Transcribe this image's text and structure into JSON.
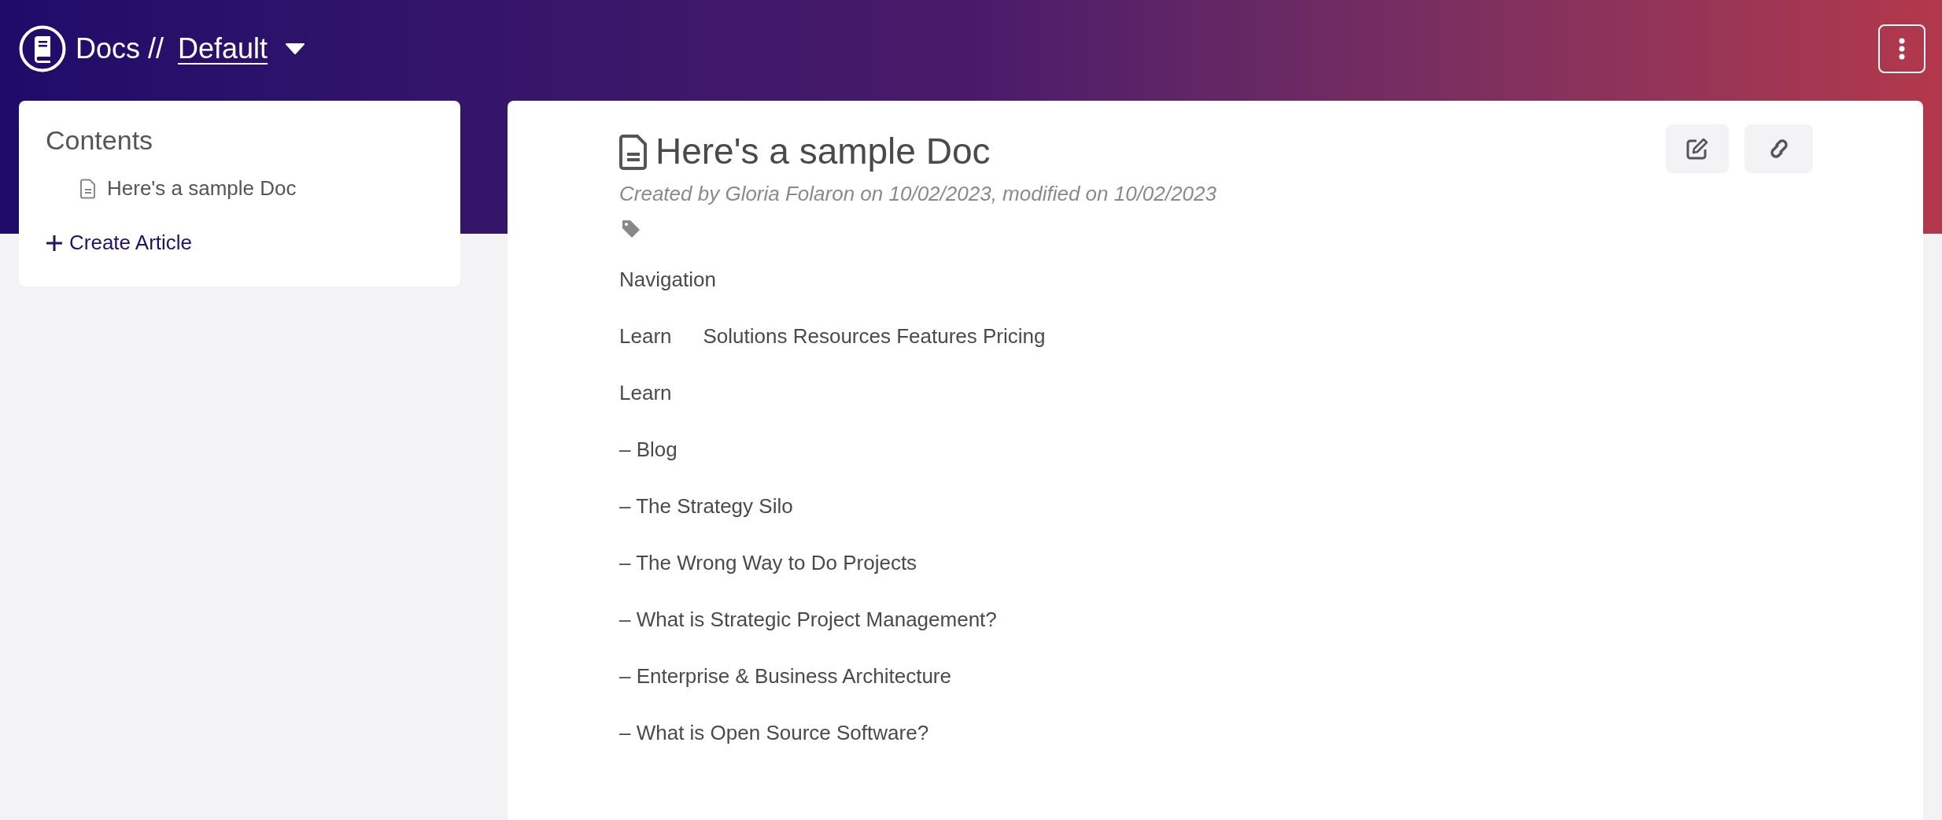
{
  "header": {
    "app": "Docs //",
    "space": "Default"
  },
  "sidebar": {
    "title": "Contents",
    "items": [
      {
        "label": "Here's a sample Doc",
        "selected": false
      }
    ],
    "create": "Create Article"
  },
  "doc": {
    "title": "Here's a sample Doc",
    "meta": "Created by Gloria Folaron on 10/02/2023, modified on 10/02/2023",
    "paragraphs": [
      {
        "parts": [
          "Navigation"
        ]
      },
      {
        "parts": [
          "Learn",
          "Solutions Resources Features Pricing"
        ]
      },
      {
        "parts": [
          "Learn"
        ]
      },
      {
        "parts": [
          "– Blog"
        ]
      },
      {
        "parts": [
          "– The Strategy Silo"
        ]
      },
      {
        "parts": [
          "– The Wrong Way to Do Projects"
        ]
      },
      {
        "parts": [
          "– What is Strategic Project Management?"
        ]
      },
      {
        "parts": [
          "– Enterprise & Business Architecture"
        ]
      },
      {
        "parts": [
          "– What is Open Source Software?"
        ]
      }
    ]
  }
}
